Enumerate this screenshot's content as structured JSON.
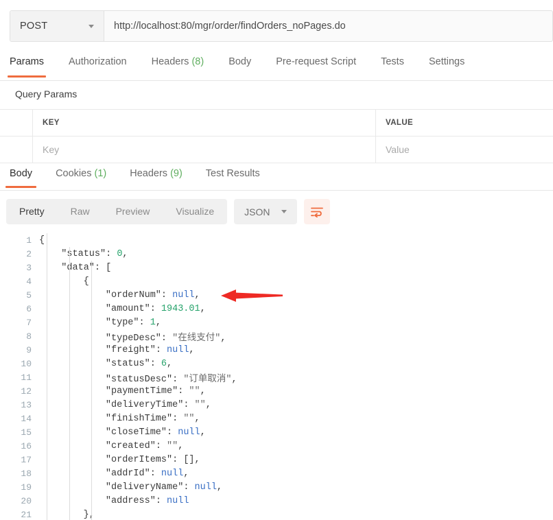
{
  "request": {
    "method": "POST",
    "method_caret_icon": "chevron-down-icon",
    "url": "http://localhost:80/mgr/order/findOrders_noPages.do",
    "tabs": [
      {
        "label": "Params",
        "active": true,
        "count": null
      },
      {
        "label": "Authorization",
        "active": false,
        "count": null
      },
      {
        "label": "Headers",
        "active": false,
        "count": "(8)"
      },
      {
        "label": "Body",
        "active": false,
        "count": null
      },
      {
        "label": "Pre-request Script",
        "active": false,
        "count": null
      },
      {
        "label": "Tests",
        "active": false,
        "count": null
      },
      {
        "label": "Settings",
        "active": false,
        "count": null
      }
    ]
  },
  "query_params": {
    "section_title": "Query Params",
    "headers": {
      "key": "KEY",
      "value": "VALUE"
    },
    "row_placeholders": {
      "key": "Key",
      "value": "Value"
    }
  },
  "response": {
    "tabs": [
      {
        "label": "Body",
        "active": true,
        "count": null
      },
      {
        "label": "Cookies",
        "active": false,
        "count": "(1)"
      },
      {
        "label": "Headers",
        "active": false,
        "count": "(9)"
      },
      {
        "label": "Test Results",
        "active": false,
        "count": null
      }
    ],
    "view_modes": [
      {
        "label": "Pretty",
        "active": true
      },
      {
        "label": "Raw",
        "active": false
      },
      {
        "label": "Preview",
        "active": false
      },
      {
        "label": "Visualize",
        "active": false
      }
    ],
    "format": {
      "selected": "JSON",
      "caret_icon": "chevron-down-icon"
    },
    "wrap_button_icon": "text-wrap-icon"
  },
  "body_lines": [
    {
      "n": "1",
      "indent": 0,
      "tokens": [
        {
          "t": "{",
          "c": "k-brk"
        }
      ]
    },
    {
      "n": "2",
      "indent": 1,
      "tokens": [
        {
          "t": "\"status\"",
          "c": "k-key"
        },
        {
          "t": ": ",
          "c": "k-punc"
        },
        {
          "t": "0",
          "c": "k-num"
        },
        {
          "t": ",",
          "c": "k-punc"
        }
      ]
    },
    {
      "n": "3",
      "indent": 1,
      "tokens": [
        {
          "t": "\"data\"",
          "c": "k-key"
        },
        {
          "t": ": ",
          "c": "k-punc"
        },
        {
          "t": "[",
          "c": "k-brk"
        }
      ]
    },
    {
      "n": "4",
      "indent": 2,
      "tokens": [
        {
          "t": "{",
          "c": "k-brk"
        }
      ]
    },
    {
      "n": "5",
      "indent": 3,
      "tokens": [
        {
          "t": "\"orderNum\"",
          "c": "k-key"
        },
        {
          "t": ": ",
          "c": "k-punc"
        },
        {
          "t": "null",
          "c": "k-null"
        },
        {
          "t": ",",
          "c": "k-punc"
        }
      ]
    },
    {
      "n": "6",
      "indent": 3,
      "tokens": [
        {
          "t": "\"amount\"",
          "c": "k-key"
        },
        {
          "t": ": ",
          "c": "k-punc"
        },
        {
          "t": "1943.01",
          "c": "k-num"
        },
        {
          "t": ",",
          "c": "k-punc"
        }
      ]
    },
    {
      "n": "7",
      "indent": 3,
      "tokens": [
        {
          "t": "\"type\"",
          "c": "k-key"
        },
        {
          "t": ": ",
          "c": "k-punc"
        },
        {
          "t": "1",
          "c": "k-num"
        },
        {
          "t": ",",
          "c": "k-punc"
        }
      ]
    },
    {
      "n": "8",
      "indent": 3,
      "tokens": [
        {
          "t": "\"typeDesc\"",
          "c": "k-key"
        },
        {
          "t": ": ",
          "c": "k-punc"
        },
        {
          "t": "\"在线支付\"",
          "c": "k-str"
        },
        {
          "t": ",",
          "c": "k-punc"
        }
      ]
    },
    {
      "n": "9",
      "indent": 3,
      "tokens": [
        {
          "t": "\"freight\"",
          "c": "k-key"
        },
        {
          "t": ": ",
          "c": "k-punc"
        },
        {
          "t": "null",
          "c": "k-null"
        },
        {
          "t": ",",
          "c": "k-punc"
        }
      ]
    },
    {
      "n": "10",
      "indent": 3,
      "tokens": [
        {
          "t": "\"status\"",
          "c": "k-key"
        },
        {
          "t": ": ",
          "c": "k-punc"
        },
        {
          "t": "6",
          "c": "k-num"
        },
        {
          "t": ",",
          "c": "k-punc"
        }
      ]
    },
    {
      "n": "11",
      "indent": 3,
      "tokens": [
        {
          "t": "\"statusDesc\"",
          "c": "k-key"
        },
        {
          "t": ": ",
          "c": "k-punc"
        },
        {
          "t": "\"订单取消\"",
          "c": "k-str"
        },
        {
          "t": ",",
          "c": "k-punc"
        }
      ]
    },
    {
      "n": "12",
      "indent": 3,
      "tokens": [
        {
          "t": "\"paymentTime\"",
          "c": "k-key"
        },
        {
          "t": ": ",
          "c": "k-punc"
        },
        {
          "t": "\"\"",
          "c": "k-str"
        },
        {
          "t": ",",
          "c": "k-punc"
        }
      ]
    },
    {
      "n": "13",
      "indent": 3,
      "tokens": [
        {
          "t": "\"deliveryTime\"",
          "c": "k-key"
        },
        {
          "t": ": ",
          "c": "k-punc"
        },
        {
          "t": "\"\"",
          "c": "k-str"
        },
        {
          "t": ",",
          "c": "k-punc"
        }
      ]
    },
    {
      "n": "14",
      "indent": 3,
      "tokens": [
        {
          "t": "\"finishTime\"",
          "c": "k-key"
        },
        {
          "t": ": ",
          "c": "k-punc"
        },
        {
          "t": "\"\"",
          "c": "k-str"
        },
        {
          "t": ",",
          "c": "k-punc"
        }
      ]
    },
    {
      "n": "15",
      "indent": 3,
      "tokens": [
        {
          "t": "\"closeTime\"",
          "c": "k-key"
        },
        {
          "t": ": ",
          "c": "k-punc"
        },
        {
          "t": "null",
          "c": "k-null"
        },
        {
          "t": ",",
          "c": "k-punc"
        }
      ]
    },
    {
      "n": "16",
      "indent": 3,
      "tokens": [
        {
          "t": "\"created\"",
          "c": "k-key"
        },
        {
          "t": ": ",
          "c": "k-punc"
        },
        {
          "t": "\"\"",
          "c": "k-str"
        },
        {
          "t": ",",
          "c": "k-punc"
        }
      ]
    },
    {
      "n": "17",
      "indent": 3,
      "tokens": [
        {
          "t": "\"orderItems\"",
          "c": "k-key"
        },
        {
          "t": ": ",
          "c": "k-punc"
        },
        {
          "t": "[]",
          "c": "k-brk"
        },
        {
          "t": ",",
          "c": "k-punc"
        }
      ]
    },
    {
      "n": "18",
      "indent": 3,
      "tokens": [
        {
          "t": "\"addrId\"",
          "c": "k-key"
        },
        {
          "t": ": ",
          "c": "k-punc"
        },
        {
          "t": "null",
          "c": "k-null"
        },
        {
          "t": ",",
          "c": "k-punc"
        }
      ]
    },
    {
      "n": "19",
      "indent": 3,
      "tokens": [
        {
          "t": "\"deliveryName\"",
          "c": "k-key"
        },
        {
          "t": ": ",
          "c": "k-punc"
        },
        {
          "t": "null",
          "c": "k-null"
        },
        {
          "t": ",",
          "c": "k-punc"
        }
      ]
    },
    {
      "n": "20",
      "indent": 3,
      "tokens": [
        {
          "t": "\"address\"",
          "c": "k-key"
        },
        {
          "t": ": ",
          "c": "k-punc"
        },
        {
          "t": "null",
          "c": "k-null"
        }
      ]
    },
    {
      "n": "21",
      "indent": 2,
      "tokens": [
        {
          "t": "},",
          "c": "k-brk"
        }
      ]
    }
  ],
  "annotation": {
    "arrow_color": "#ee2a24",
    "points_at_line": "5"
  },
  "colors": {
    "accent": "#ef6c3e",
    "count_green": "#5fae5f",
    "json_number": "#26a36b",
    "json_null": "#3a6fc4"
  }
}
